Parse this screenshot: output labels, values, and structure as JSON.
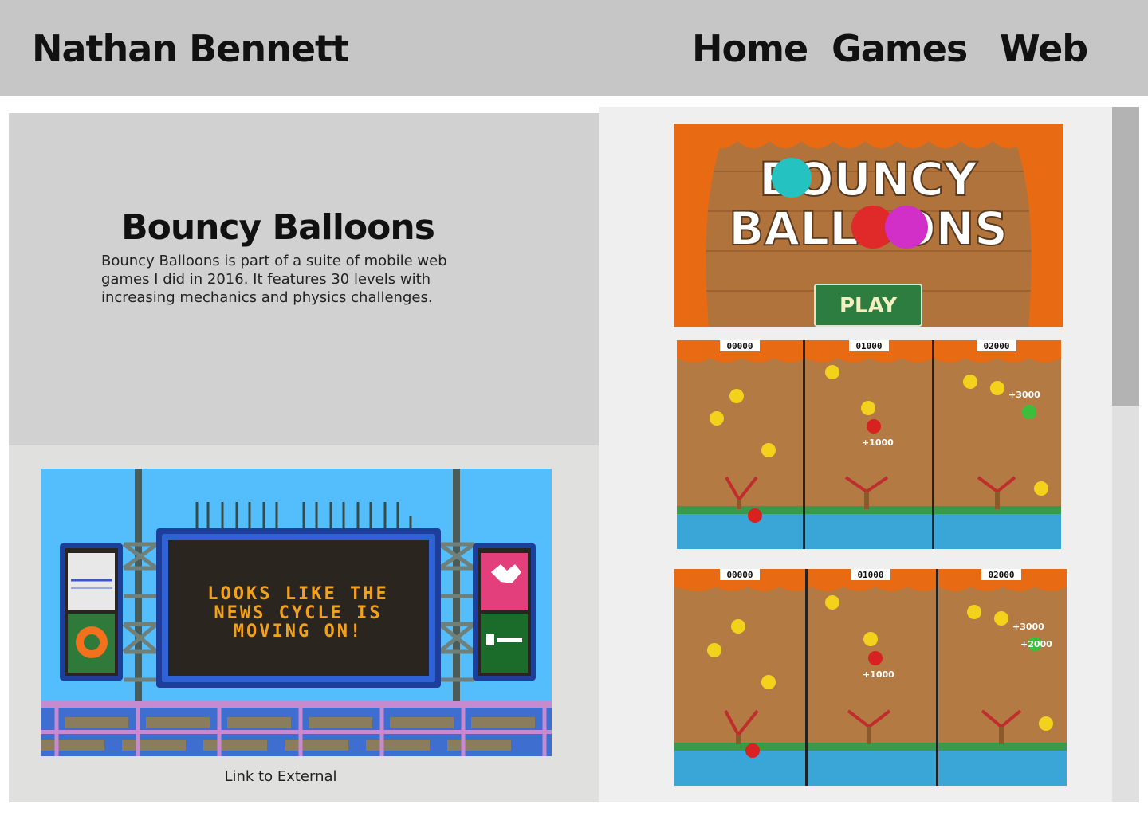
{
  "header": {
    "brand": "Nathan Bennett",
    "nav": [
      {
        "label": "Home"
      },
      {
        "label": "Games"
      },
      {
        "label": "Web"
      }
    ]
  },
  "project": {
    "title": "Bouncy Balloons",
    "description": "Bouncy Balloons is part of a suite of mobile web games I did in 2016. It features 30 levels with increasing mechanics and physics challenges."
  },
  "feature": {
    "scoreboard_lines": [
      "LOOKS LIKE THE",
      "NEWS CYCLE IS",
      "MOVING ON!"
    ],
    "link_label": "Link to External"
  },
  "gallery": {
    "title_screen": {
      "logo_line1": "BOUNCY",
      "logo_line2": "BALLOONS",
      "play_label": "PLAY"
    },
    "gameplay_scores": [
      "00000",
      "01000",
      "02000"
    ],
    "popups": [
      "+1000",
      "+3000",
      "+2000"
    ]
  }
}
